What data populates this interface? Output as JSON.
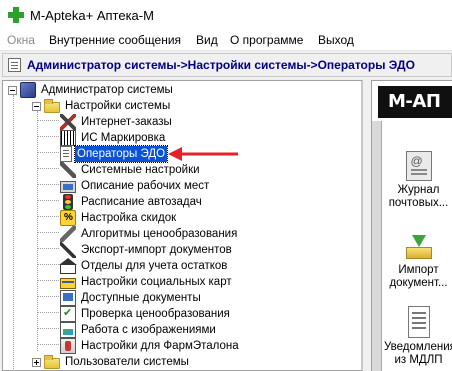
{
  "window": {
    "title": "M-Apteka+ Аптека-М"
  },
  "menu": [
    {
      "label": "Окна",
      "disabled": true
    },
    {
      "label": "Внутренние сообщения",
      "disabled": false
    },
    {
      "label": "Вид",
      "disabled": false
    },
    {
      "label": "О программе",
      "disabled": false
    },
    {
      "label": "Выход",
      "disabled": false
    }
  ],
  "breadcrumb": {
    "text": "Администратор системы->Настройки системы->Операторы ЭДО"
  },
  "tree": {
    "root": {
      "label": "Администратор системы",
      "icon": "admin-icon"
    },
    "settings_folder": {
      "label": "Настройки системы",
      "icon": "folder-icon"
    },
    "items": [
      {
        "label": "Интернет-заказы",
        "icon": "tools-icon"
      },
      {
        "label": "ИС Маркировка",
        "icon": "barcode-icon"
      },
      {
        "label": "Операторы ЭДО",
        "icon": "document-icon",
        "selected": true
      },
      {
        "label": "Системные настройки",
        "icon": "wrench-icon"
      },
      {
        "label": "Описание рабочих мест",
        "icon": "workstation-icon"
      },
      {
        "label": "Расписание автозадач",
        "icon": "traffic-light-icon"
      },
      {
        "label": "Настройка скидок",
        "icon": "percent-icon"
      },
      {
        "label": "Алгоритмы ценообразования",
        "icon": "tools-icon"
      },
      {
        "label": "Экспорт-импорт документов",
        "icon": "export-import-icon"
      },
      {
        "label": "Отделы для учета остатков",
        "icon": "house-icon"
      },
      {
        "label": "Настройки социальных карт",
        "icon": "card-icon"
      },
      {
        "label": "Доступные документы",
        "icon": "documents-icon"
      },
      {
        "label": "Проверка ценообразования",
        "icon": "check-icon"
      },
      {
        "label": "Работа с изображениями",
        "icon": "image-icon"
      },
      {
        "label": "Настройки для ФармЭталона",
        "icon": "pharmacy-icon"
      }
    ],
    "users_folder": {
      "label": "Пользователи системы",
      "icon": "folder-icon"
    }
  },
  "right_panel": {
    "banner": "М-АП",
    "tiles": [
      {
        "line1": "Журнал",
        "line2": "почтовых...",
        "icon": "journal-icon"
      },
      {
        "line1": "Импорт",
        "line2": "документ...",
        "icon": "import-icon"
      },
      {
        "line1": "Уведомления",
        "line2": "из МДЛП",
        "icon": "mdlp-icon"
      }
    ]
  },
  "colors": {
    "selection": "#0a53d6",
    "breadcrumb_text": "#000080",
    "annotation_arrow": "#e8202a"
  }
}
